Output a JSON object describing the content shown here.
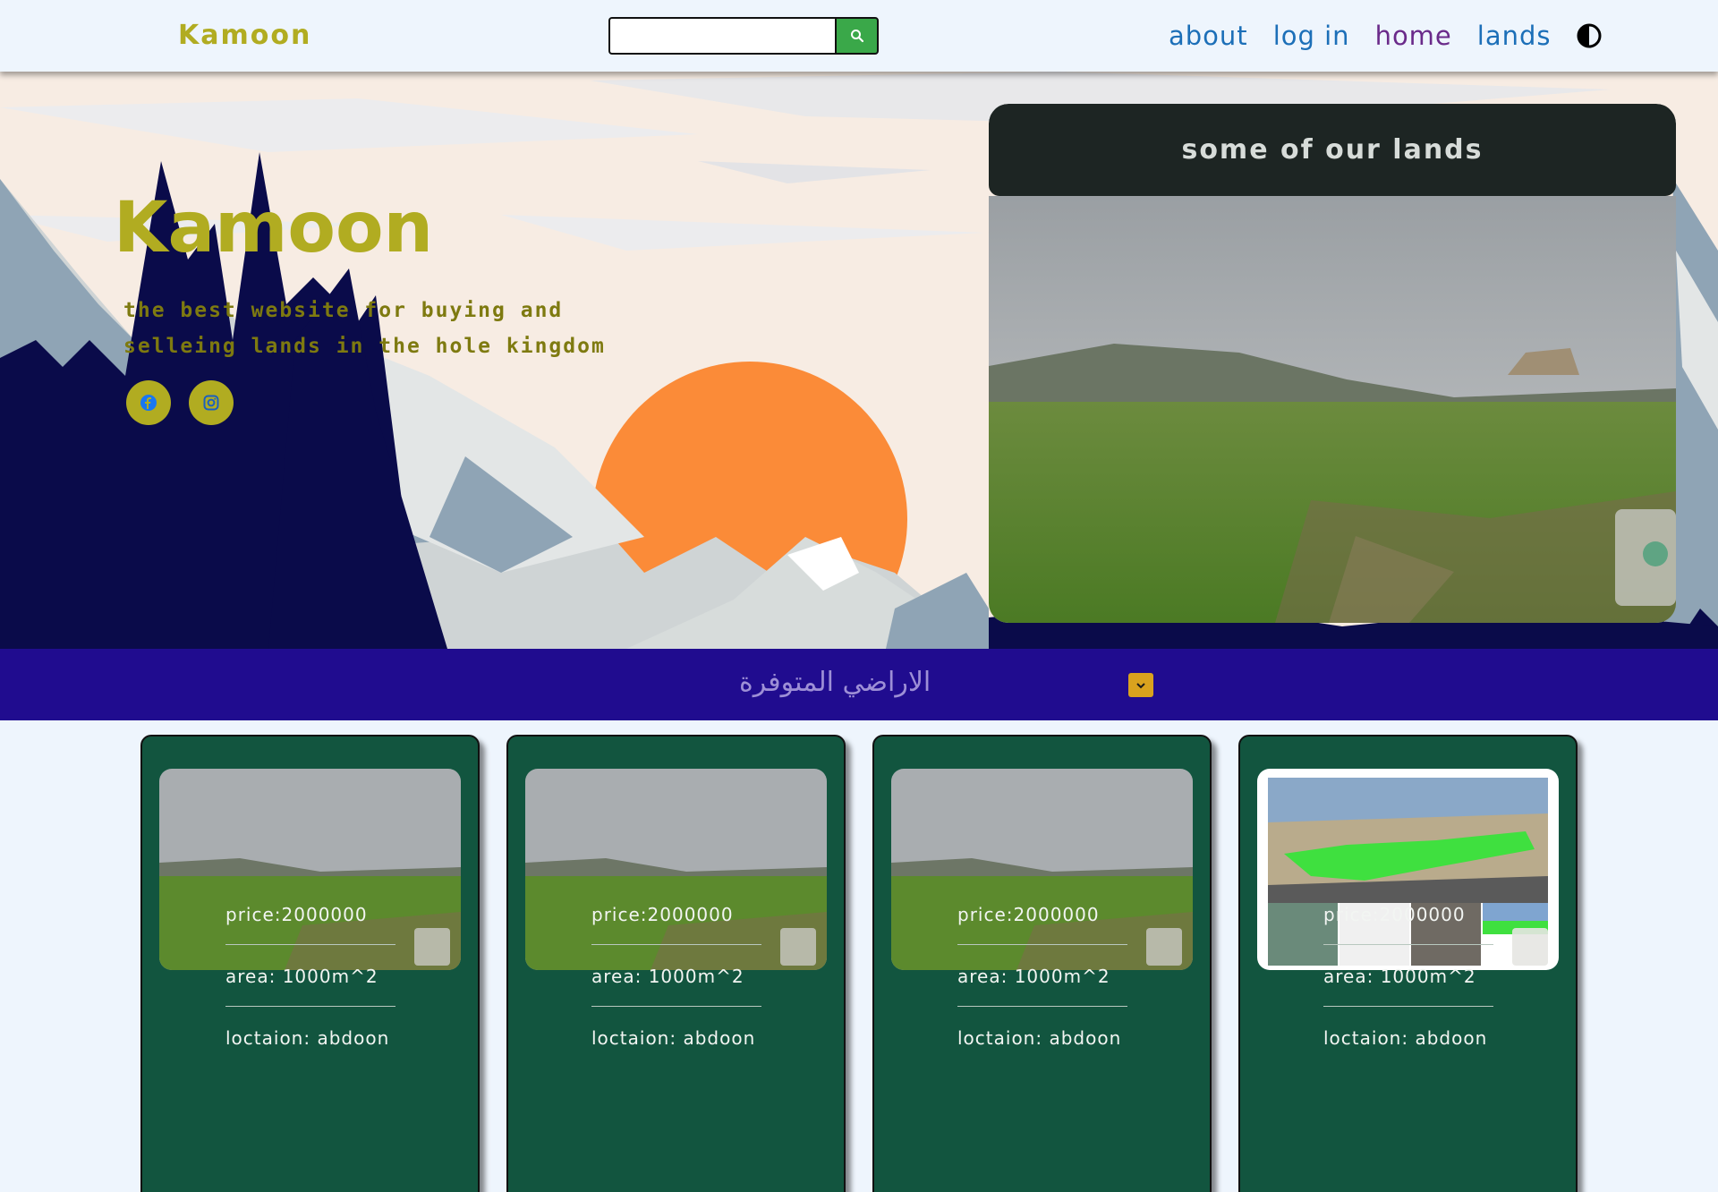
{
  "navbar": {
    "brand": "Kamoon",
    "search": {
      "value": "",
      "placeholder": ""
    },
    "links": [
      {
        "label": "about"
      },
      {
        "label": "log in"
      },
      {
        "label": "home"
      },
      {
        "label": "lands"
      }
    ]
  },
  "hero": {
    "title": "Kamoon",
    "tagline_line1": "the best website for buying and",
    "tagline_line2": "selleing lands in the hole kingdom",
    "showcase_title": "some of our lands"
  },
  "filter": {
    "label": "الاراضي المتوفرة"
  },
  "cards": [
    {
      "price": "price:2000000",
      "area": "area: 1000m^2",
      "location": "loctaion: abdoon"
    },
    {
      "price": "price:2000000",
      "area": "area: 1000m^2",
      "location": "loctaion: abdoon"
    },
    {
      "price": "price:2000000",
      "area": "area: 1000m^2",
      "location": "loctaion: abdoon"
    },
    {
      "price": "price:2000000",
      "area": "area: 1000m^2",
      "location": "loctaion: abdoon"
    }
  ],
  "colors": {
    "brand": "#b1ac21",
    "navy": "#0a0b4a",
    "sun": "#fb8b38",
    "filter_bar": "#200c8f",
    "card": "#12553f",
    "search_button": "#3aa849"
  },
  "icons": [
    "search-icon",
    "theme-toggle-icon",
    "facebook-icon",
    "instagram-icon",
    "chevron-down-icon",
    "map-pin-watermark-icon"
  ]
}
